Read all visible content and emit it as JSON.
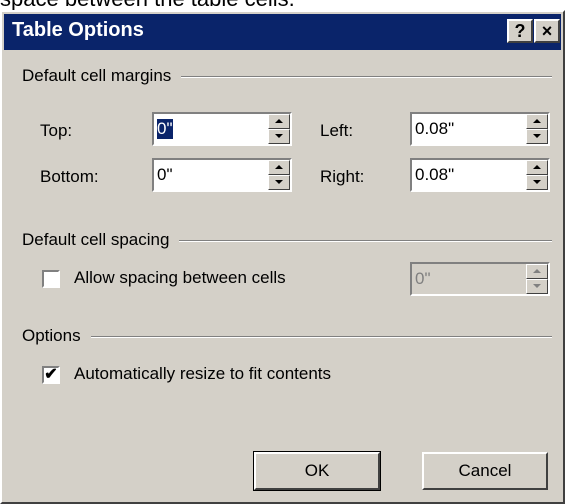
{
  "background_caption": "space between the table cells.",
  "dialog": {
    "title": "Table Options",
    "help_btn": "?",
    "close_btn": "×",
    "margins_group": "Default cell margins",
    "margins": {
      "top_label": "Top:",
      "top_value": "0\"",
      "bottom_label": "Bottom:",
      "bottom_value": "0\"",
      "left_label": "Left:",
      "left_value": "0.08\"",
      "right_label": "Right:",
      "right_value": "0.08\""
    },
    "spacing_group": "Default cell spacing",
    "spacing_checkbox": "Allow spacing between cells",
    "spacing_checked": false,
    "spacing_value": "0\"",
    "options_group": "Options",
    "resize_checkbox": "Automatically resize to fit contents",
    "resize_checked": true,
    "ok_label": "OK",
    "cancel_label": "Cancel"
  }
}
